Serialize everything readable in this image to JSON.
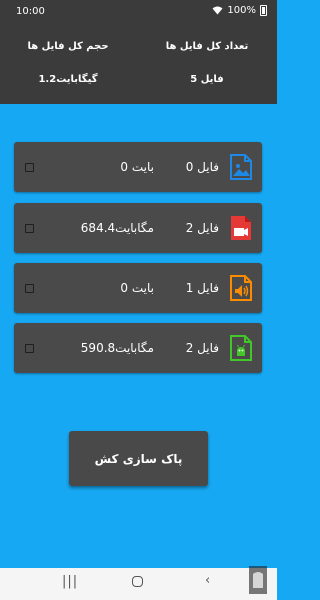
{
  "status_bar": {
    "time": "10:00",
    "battery": "100%"
  },
  "header": {
    "total_count_label": "تعداد کل فایل ها",
    "total_count_value": "5 فایل",
    "total_size_label": "حجم کل فایل ها",
    "total_size_value": "1.2گیگابایت"
  },
  "categories": [
    {
      "count": "0 فایل",
      "size": "0 بایت",
      "icon": "image-file-icon",
      "color": "#1e88e5"
    },
    {
      "count": "2 فایل",
      "size": "684.4مگابایت",
      "icon": "video-file-icon",
      "color": "#e53935"
    },
    {
      "count": "1 فایل",
      "size": "0 بایت",
      "icon": "audio-file-icon",
      "color": "#fb8c00"
    },
    {
      "count": "2 فایل",
      "size": "590.8مگابایت",
      "icon": "apk-file-icon",
      "color": "#43c628"
    }
  ],
  "clean_button": {
    "label": "پاک سازی کش"
  },
  "colors": {
    "background": "#16a8f2",
    "header": "#3b3b3b",
    "card": "#4a4a4a"
  }
}
